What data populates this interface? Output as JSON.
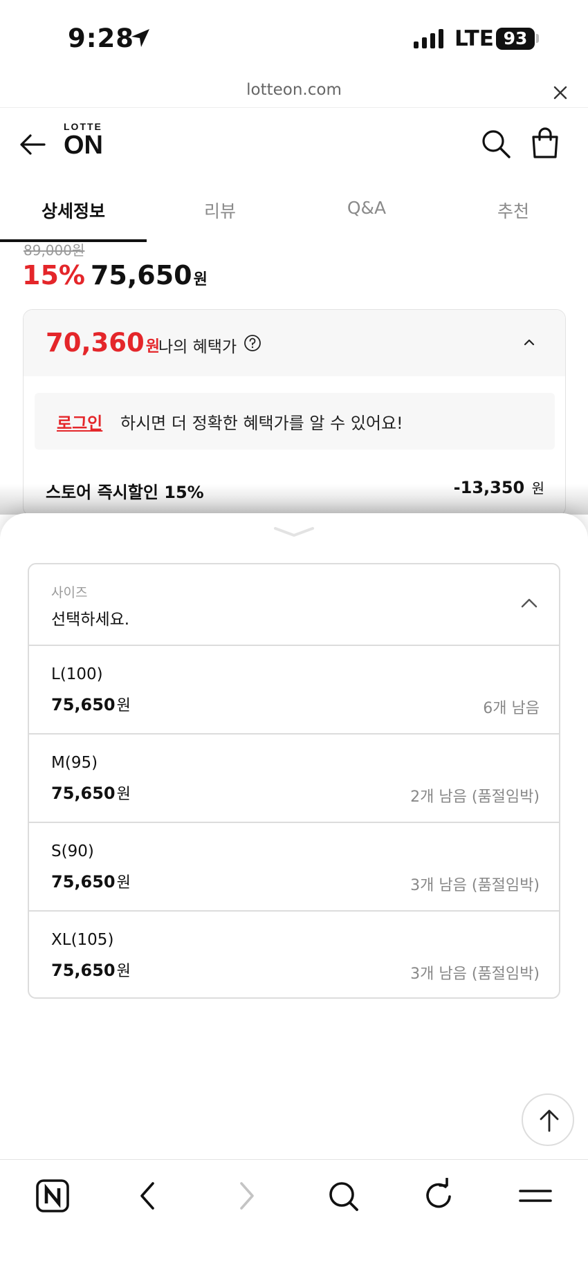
{
  "status": {
    "time": "9:28",
    "network": "LTE",
    "battery": "93"
  },
  "browser": {
    "url": "lotteon.com"
  },
  "header": {
    "logo_top": "LOTTE",
    "logo_bottom": "ON"
  },
  "tabs": [
    {
      "label": "상세정보",
      "active": true
    },
    {
      "label": "리뷰"
    },
    {
      "label": "Q&A"
    },
    {
      "label": "추천"
    }
  ],
  "product": {
    "original_price": "89,000원",
    "discount_rate": "15%",
    "sale_price": "75,650",
    "won": "원"
  },
  "benefit": {
    "price": "70,360",
    "won": "원",
    "label": "나의 혜택가",
    "login_link": "로그인",
    "login_message": "하시면 더 정확한 혜택가를 알 수 있어요!",
    "discount_label": "스토어 즉시할인 15%",
    "discount_amount": "-13,350",
    "discount_won": "원"
  },
  "option": {
    "label": "사이즈",
    "placeholder": "선택하세요.",
    "items": [
      {
        "name": "L(100)",
        "price": "75,650",
        "won": "원",
        "stock": "6개 남음"
      },
      {
        "name": "M(95)",
        "price": "75,650",
        "won": "원",
        "stock": "2개 남음 (품절임박)"
      },
      {
        "name": "S(90)",
        "price": "75,650",
        "won": "원",
        "stock": "3개 남음 (품절임박)"
      },
      {
        "name": "XL(105)",
        "price": "75,650",
        "won": "원",
        "stock": "3개 남음 (품절임박)"
      }
    ]
  },
  "colors": {
    "accent_red": "#e4262a",
    "text": "#111111",
    "muted": "#888888"
  }
}
